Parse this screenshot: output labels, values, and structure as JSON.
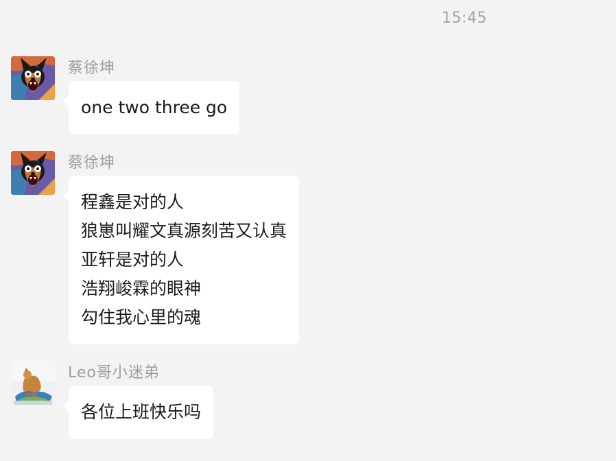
{
  "chat": {
    "timestamp": "15:45",
    "messages": [
      {
        "sender": "蔡徐坤",
        "avatar": "cartoon-dog-avatar",
        "lines": [
          "one two three go"
        ]
      },
      {
        "sender": "蔡徐坤",
        "avatar": "cartoon-dog-avatar",
        "lines": [
          "程鑫是对的人",
          "狼崽叫耀文真源刻苦又认真",
          "亚轩是对的人",
          "浩翔峻霖的眼神",
          "勾住我心里的魂"
        ]
      },
      {
        "sender": "Leo哥小迷弟",
        "avatar": "figurine-photo-avatar",
        "lines": [
          "各位上班快乐吗"
        ]
      }
    ]
  },
  "colors": {
    "background": "#f3f3f3",
    "bubble": "#ffffff",
    "meta_text": "#9d9d9d"
  }
}
